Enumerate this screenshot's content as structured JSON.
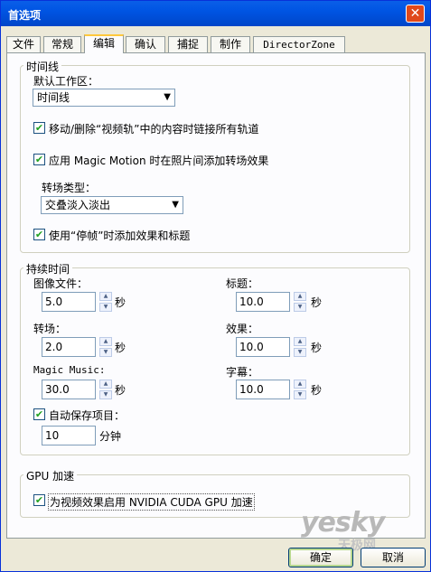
{
  "window": {
    "title": "首选项",
    "close_glyph": "✕"
  },
  "tabs": [
    {
      "label": "文件"
    },
    {
      "label": "常规"
    },
    {
      "label": "编辑"
    },
    {
      "label": "确认"
    },
    {
      "label": "捕捉"
    },
    {
      "label": "制作"
    },
    {
      "label": "DirectorZone"
    }
  ],
  "active_tab": "编辑",
  "timeline": {
    "group_title": "时间线",
    "workspace_label": "默认工作区：",
    "workspace_value": "时间线",
    "ripple_label": "移动/删除“视频轨”中的内容时链接所有轨道",
    "ripple_checked": true,
    "magic_motion_label": "应用 Magic Motion 时在照片间添加转场效果",
    "magic_motion_checked": true,
    "transition_type_label": "转场类型：",
    "transition_type_value": "交叠淡入淡出",
    "freeze_label": "使用“停帧”时添加效果和标题",
    "freeze_checked": true
  },
  "duration": {
    "group_title": "持续时间",
    "image_label": "图像文件：",
    "image_value": "5.0",
    "transition_label": "转场：",
    "transition_value": "2.0",
    "magic_music_label": "Magic Music:",
    "magic_music_value": "30.0",
    "title_label": "标题：",
    "title_value": "10.0",
    "effect_label": "效果：",
    "effect_value": "10.0",
    "subtitle_label": "字幕：",
    "subtitle_value": "10.0",
    "unit_seconds": "秒",
    "autosave_label": "自动保存项目：",
    "autosave_checked": true,
    "autosave_value": "10",
    "unit_minutes": "分钟"
  },
  "gpu": {
    "group_title": "GPU 加速",
    "cuda_label": "为视频效果启用 NVIDIA CUDA GPU 加速",
    "cuda_checked": true
  },
  "buttons": {
    "ok": "确定",
    "cancel": "取消"
  },
  "watermark": {
    "brand": "yesky",
    "subtitle": "天极网"
  },
  "colors": {
    "titlebar": "#0054e3",
    "check": "#21a121",
    "active_tab_accent": "#ffc83c"
  }
}
